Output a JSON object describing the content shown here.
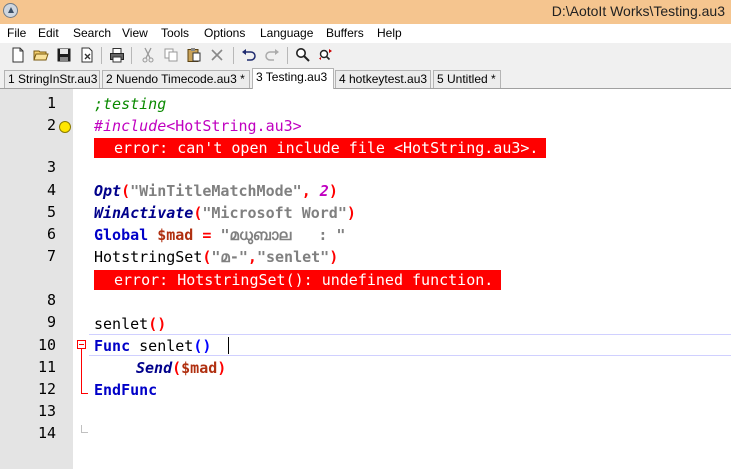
{
  "window": {
    "title": "D:\\AotoIt Works\\Testing.au3",
    "app_icon": "autoit-icon"
  },
  "menu": [
    "File",
    "Edit",
    "Search",
    "View",
    "Tools",
    "Options",
    "Language",
    "Buffers",
    "Help"
  ],
  "toolbar": {
    "icons": [
      "new-file-icon",
      "open-folder-icon",
      "save-icon",
      "close-file-icon",
      "print-icon",
      "cut-icon",
      "copy-icon",
      "paste-icon",
      "delete-icon",
      "undo-icon",
      "redo-icon",
      "find-icon",
      "replace-icon"
    ]
  },
  "tabs": [
    {
      "label": "1 StringInStr.au3",
      "active": false
    },
    {
      "label": "2 Nuendo Timecode.au3 *",
      "active": false
    },
    {
      "label": "3 Testing.au3",
      "active": true
    },
    {
      "label": "4 hotkeytest.au3",
      "active": false
    },
    {
      "label": "5 Untitled *",
      "active": false
    }
  ],
  "editor": {
    "line_numbers": [
      "1",
      "2",
      "3",
      "4",
      "5",
      "6",
      "7",
      "8",
      "9",
      "10",
      "11",
      "12",
      "13",
      "14"
    ],
    "lines": {
      "l1": {
        "comment": ";testing"
      },
      "l2": {
        "directive": "#include",
        "path": "<HotString.au3>"
      },
      "err1": "error: can't open include file <HotString.au3>.",
      "l4": {
        "fn": "Opt",
        "open": "(",
        "str": "\"WinTitleMatchMode\"",
        "comma": ", ",
        "num": "2",
        "close": ")"
      },
      "l5": {
        "fn": "WinActivate",
        "open": "(",
        "str": "\"Microsoft Word\"",
        "close": ")"
      },
      "l6": {
        "kw": "Global",
        "var": "$mad",
        "op": "=",
        "str": "\"മധുബാല   : \""
      },
      "l7": {
        "plain": "HotstringSet",
        "open": "(",
        "str1": "\"മ-\"",
        "comma": ",",
        "str2": "\"senlet\"",
        "close": ")"
      },
      "err2": "error: HotstringSet(): undefined function.",
      "l9": {
        "plain": "senlet",
        "parens": "()"
      },
      "l10": {
        "kw": "Func",
        "plain": " senlet",
        "parens": "()"
      },
      "l11": {
        "fn": "Send",
        "open": "(",
        "var": "$mad",
        "close": ")"
      },
      "l12": {
        "kw": "EndFunc"
      }
    }
  }
}
